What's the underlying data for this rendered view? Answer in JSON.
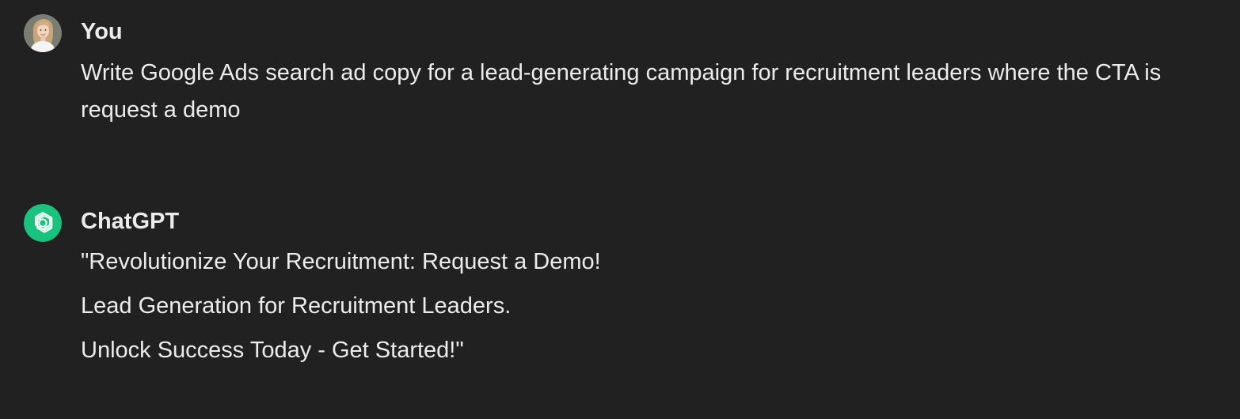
{
  "conversation": {
    "user_message": {
      "author": "You",
      "avatar_icon": "user-avatar",
      "text": "Write Google Ads search ad copy for a lead-generating campaign for recruitment leaders where the CTA is request a demo"
    },
    "assistant_message": {
      "author": "ChatGPT",
      "avatar_icon": "openai-logo-icon",
      "avatar_color": "#19c37d",
      "lines": [
        "\"Revolutionize Your Recruitment: Request a Demo!",
        "Lead Generation for Recruitment Leaders.",
        "Unlock Success Today - Get Started!\""
      ]
    }
  },
  "theme": {
    "background": "#212121",
    "text": "#ececec"
  }
}
